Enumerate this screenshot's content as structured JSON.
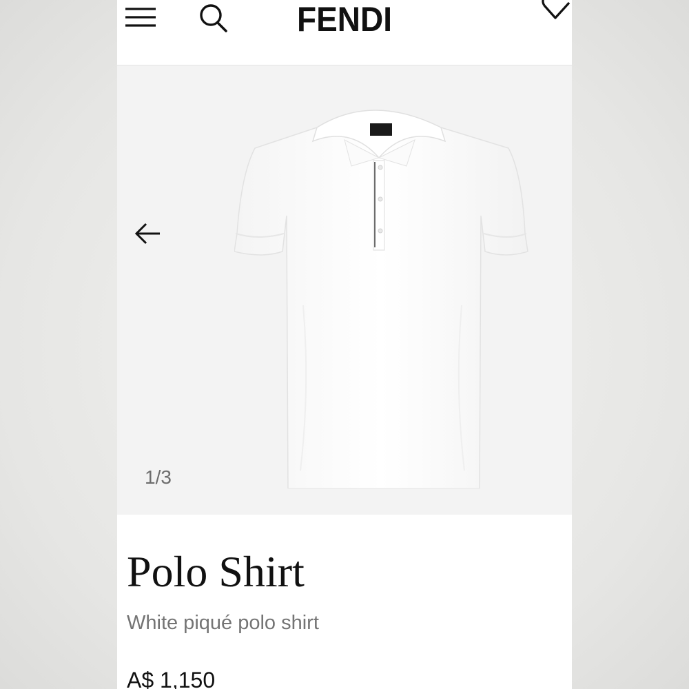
{
  "header": {
    "brand": "FENDI",
    "menu_icon": "hamburger-menu-icon",
    "search_icon": "search-icon",
    "wishlist_icon": "heart-icon"
  },
  "gallery": {
    "counter": "1/3",
    "prev_icon": "arrow-left-icon",
    "current_index": 1,
    "total": 3
  },
  "product": {
    "name": "Polo Shirt",
    "description": "White piqué polo shirt",
    "price": "A$ 1,150"
  },
  "colors": {
    "text": "#111111",
    "muted": "#747474",
    "gallery_bg": "#f3f3f3"
  }
}
